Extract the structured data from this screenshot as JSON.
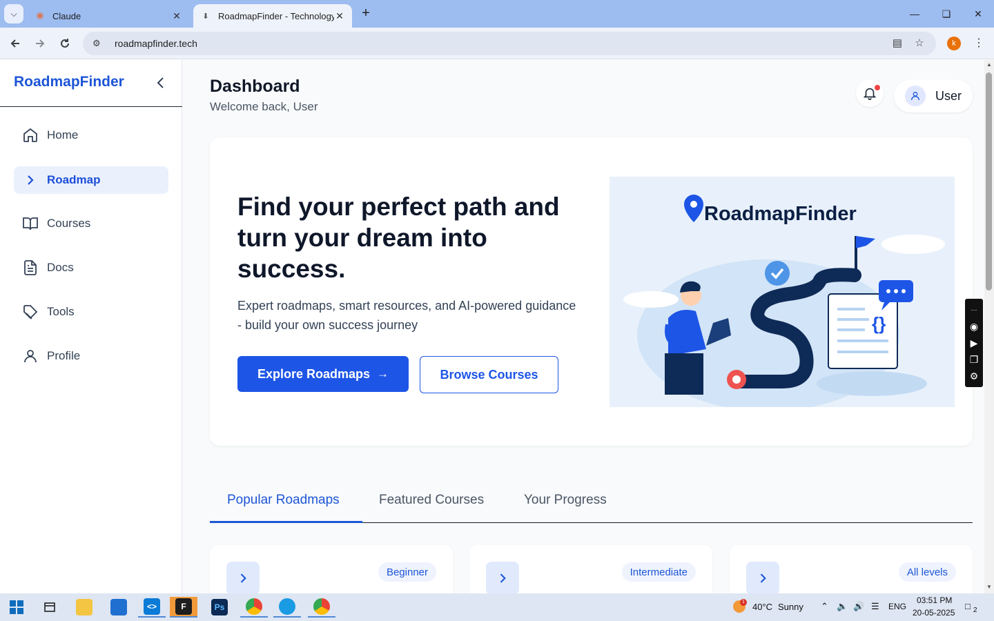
{
  "browser": {
    "tabs": [
      {
        "title": "Claude",
        "active": false
      },
      {
        "title": "RoadmapFinder - Technology S",
        "active": true
      }
    ],
    "url": "roadmapfinder.tech",
    "profile_initial": "k"
  },
  "sidebar": {
    "brand": "RoadmapFinder",
    "items": [
      {
        "label": "Home",
        "icon": "home-icon"
      },
      {
        "label": "Roadmap",
        "icon": "chevron-right-icon",
        "active": true
      },
      {
        "label": "Courses",
        "icon": "book-icon"
      },
      {
        "label": "Docs",
        "icon": "document-icon"
      },
      {
        "label": "Tools",
        "icon": "tag-icon"
      },
      {
        "label": "Profile",
        "icon": "user-icon"
      }
    ]
  },
  "header": {
    "title": "Dashboard",
    "subtitle": "Welcome back, User",
    "user_name": "User"
  },
  "hero": {
    "headline": "Find your perfect path and turn your dream into success.",
    "description": "Expert roadmaps, smart resources, and AI-powered guidance - build your own success journey",
    "primary_button": "Explore Roadmaps",
    "secondary_button": "Browse Courses",
    "illustration_brand": "RoadmapFinder"
  },
  "tabs": [
    {
      "label": "Popular Roadmaps",
      "active": true
    },
    {
      "label": "Featured Courses",
      "active": false
    },
    {
      "label": "Your Progress",
      "active": false
    }
  ],
  "cards": [
    {
      "badge": "Beginner"
    },
    {
      "badge": "Intermediate"
    },
    {
      "badge": "All levels"
    }
  ],
  "taskbar": {
    "weather_temp": "40°C",
    "weather_desc": "Sunny",
    "weather_alert": "1",
    "language": "ENG",
    "time": "03:51 PM",
    "date": "20-05-2025",
    "notifications": "2"
  },
  "colors": {
    "brand_blue": "#1d55d6",
    "primary_button": "#1d55e6",
    "active_nav_bg": "#eaf1fd"
  }
}
